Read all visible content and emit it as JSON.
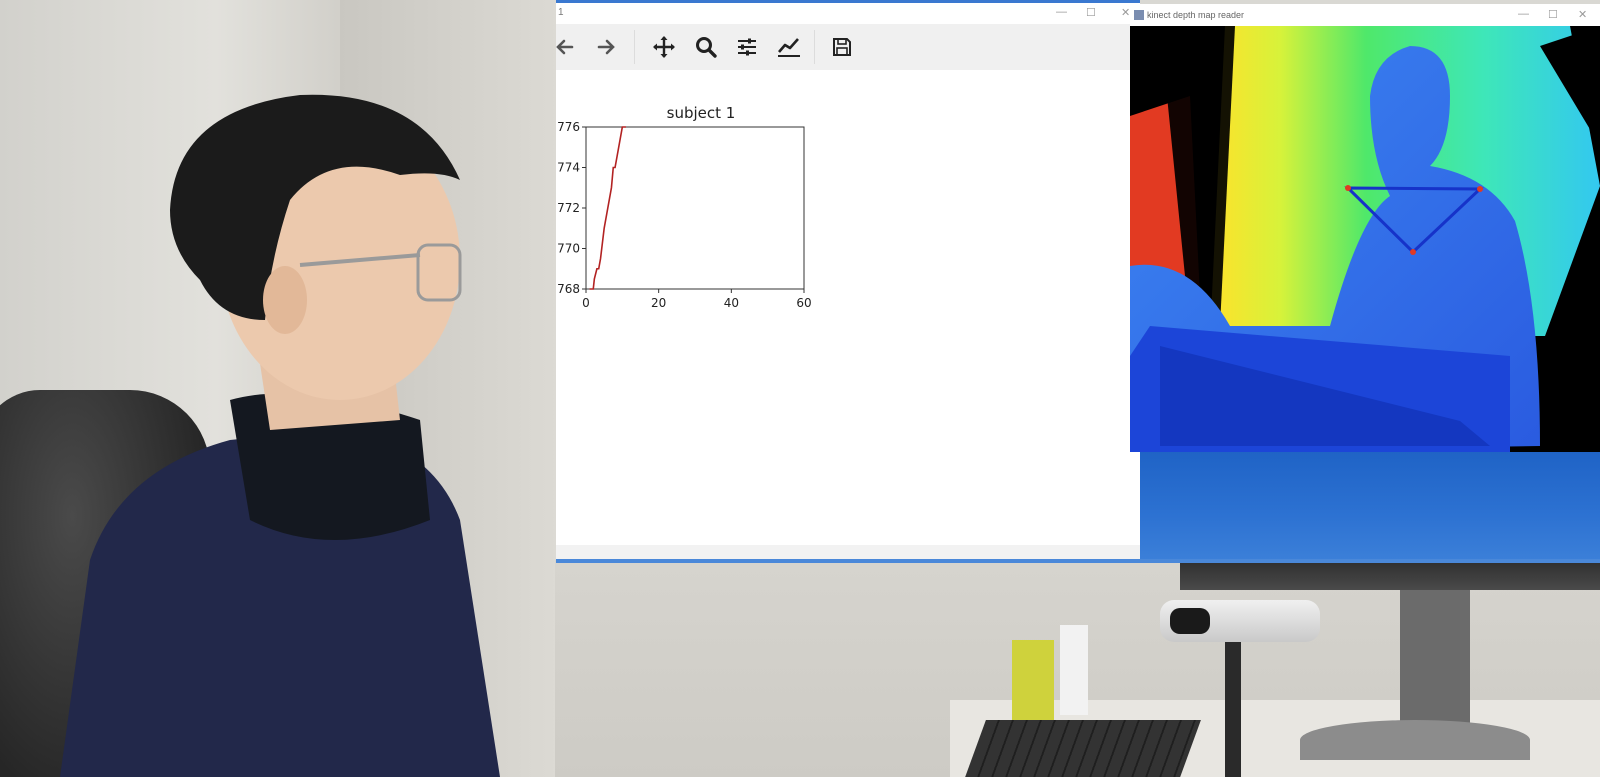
{
  "plot_window": {
    "title": "1",
    "toolbar": {
      "back": "back-icon",
      "forward": "forward-icon",
      "pan": "pan-icon",
      "zoom": "zoom-icon",
      "subplots": "configure-subplots-icon",
      "edit": "edit-axis-icon",
      "save": "save-icon"
    }
  },
  "depth_window": {
    "title": "kinect depth map reader"
  },
  "chart_data": {
    "type": "line",
    "title": "subject 1",
    "xlabel": "",
    "ylabel": "",
    "xlim": [
      0,
      60
    ],
    "ylim": [
      768,
      776
    ],
    "x_ticks": [
      "0",
      "20",
      "40",
      "60"
    ],
    "y_ticks": [
      "768",
      "770",
      "772",
      "774",
      "776"
    ],
    "series": [
      {
        "color": "#b22222",
        "x": [
          1,
          2,
          2.3,
          3,
          3.5,
          4,
          5,
          6,
          7,
          7.5,
          8,
          9,
          10,
          11
        ],
        "y": [
          768,
          768,
          768.5,
          769,
          769,
          769.5,
          771,
          772,
          773,
          774,
          774,
          775,
          776,
          776
        ]
      }
    ]
  }
}
